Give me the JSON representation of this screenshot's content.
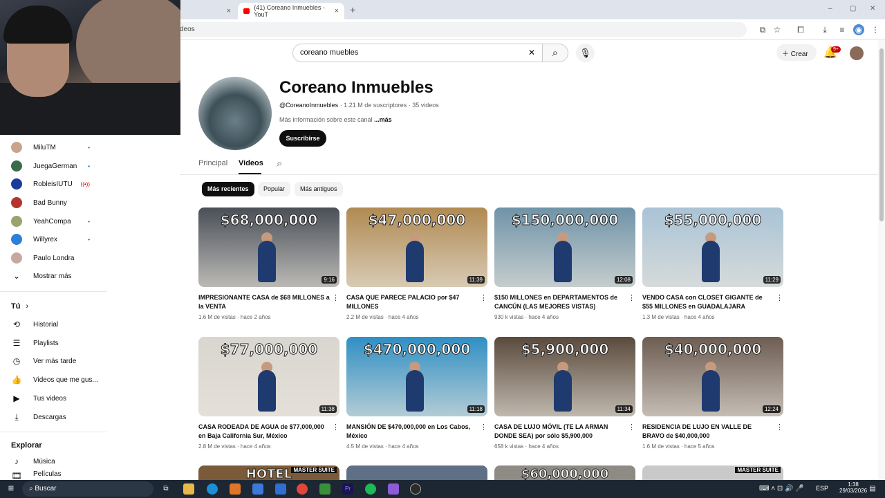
{
  "browser": {
    "tabs": [
      {
        "label": "",
        "close": "×"
      },
      {
        "label": "(41) Coreano Inmuebles - YouT",
        "close": "×"
      }
    ],
    "new_tab": "+",
    "url": "deos",
    "window_controls": [
      "–",
      "▢",
      "✕"
    ]
  },
  "youtube": {
    "search": {
      "value": "coreano muebles",
      "clear": "✕"
    },
    "create_label": "Crear",
    "notification_badge": "9+"
  },
  "sidebar": {
    "subscriptions": [
      {
        "label": "MiluTM",
        "indicator": "•"
      },
      {
        "label": "JuegaGerman",
        "indicator": "•"
      },
      {
        "label": "RobleisIUTU",
        "indicator": "((•))"
      },
      {
        "label": "Bad Bunny",
        "indicator": ""
      },
      {
        "label": "YeahCompa",
        "indicator": "•"
      },
      {
        "label": "Willyrex",
        "indicator": "•"
      },
      {
        "label": "Paulo Londra",
        "indicator": ""
      }
    ],
    "show_more": "Mostrar más",
    "you_heading": "Tú",
    "you_items": [
      "Historial",
      "Playlists",
      "Ver más tarde",
      "Videos que me gus...",
      "Tus videos",
      "Descargas"
    ],
    "explore_heading": "Explorar",
    "explore_items": [
      "Música",
      "Películas"
    ]
  },
  "channel": {
    "name": "Coreano Inmuebles",
    "handle": "@CoreanoInmuebles",
    "subscribers": " · 1.21 M de suscriptores · 35 videos",
    "description": "Más información sobre este canal ",
    "more": "...más",
    "subscribe_label": "Suscribirse",
    "tabs": [
      "Principal",
      "Videos"
    ],
    "chips": [
      "Más recientes",
      "Popular",
      "Más antiguos"
    ]
  },
  "videos": [
    {
      "price": "$68,000,000",
      "duration": "9:16",
      "title": "IMPRESIONANTE CASA de $68 MILLONES a la VENTA",
      "views": "1.6 M de vistas",
      "age": "hace 2 años",
      "bg": "#4a4f57"
    },
    {
      "price": "$47,000,000",
      "duration": "11:39",
      "title": "CASA QUE PARECE PALACIO por $47 MILLONES",
      "views": "2.2 M de vistas",
      "age": "hace 4 años",
      "bg": "#b08a52"
    },
    {
      "price": "$150,000,000",
      "duration": "12:08",
      "title": "$150 MILLONES en DEPARTAMENTOS de CANCÚN (LAS MEJORES VISTAS)",
      "views": "930 k vistas",
      "age": "hace 4 años",
      "bg": "#6f93a8"
    },
    {
      "price": "$55,000,000",
      "duration": "11:29",
      "title": "VENDO CASA con CLOSET GIGANTE de $55 MILLONES en GUADALAJARA",
      "views": "1.3 M de vistas",
      "age": "hace 4 años",
      "bg": "#a9c3d6"
    },
    {
      "price": "$77,000,000",
      "duration": "11:38",
      "title": "CASA RODEADA DE AGUA de $77,000,000 en Baja California Sur, México",
      "views": "2.8 M de vistas",
      "age": "hace 4 años",
      "bg": "#d9d6cf"
    },
    {
      "price": "$470,000,000",
      "duration": "11:18",
      "title": "MANSIÓN DE $470,000,000 en Los Cabos, México",
      "views": "4.5 M de vistas",
      "age": "hace 4 años",
      "bg": "#2f8fc4"
    },
    {
      "price": "$5,900,000",
      "duration": "11:34",
      "title": "CASA DE LUJO MÓVIL (TE LA ARMAN DONDE SEA) por sólo $5,900,000",
      "views": "658 k vistas",
      "age": "hace 4 años",
      "bg": "#5a4a3c"
    },
    {
      "price": "$40,000,000",
      "duration": "12:24",
      "title": "RESIDENCIA DE LUJO EN VALLE DE BRAVO de $40,000,000",
      "views": "1.6 M de vistas",
      "age": "hace 5 años",
      "bg": "#6d5c52"
    }
  ],
  "row3": [
    {
      "caption": "HOTEL",
      "tag": "MASTER SUITE",
      "bg": "#7a5a38"
    },
    {
      "caption": "",
      "tag": "",
      "bg": "#5f6f86"
    },
    {
      "caption": "$60,000,000",
      "tag": "",
      "bg": "#8e8a84"
    },
    {
      "caption": "",
      "tag": "MASTER SUITE",
      "bg": "#c9c9c9"
    }
  ],
  "taskbar": {
    "search_label": "Buscar",
    "lang": "ESP",
    "time": "1:38",
    "date": "29/03/2026"
  }
}
